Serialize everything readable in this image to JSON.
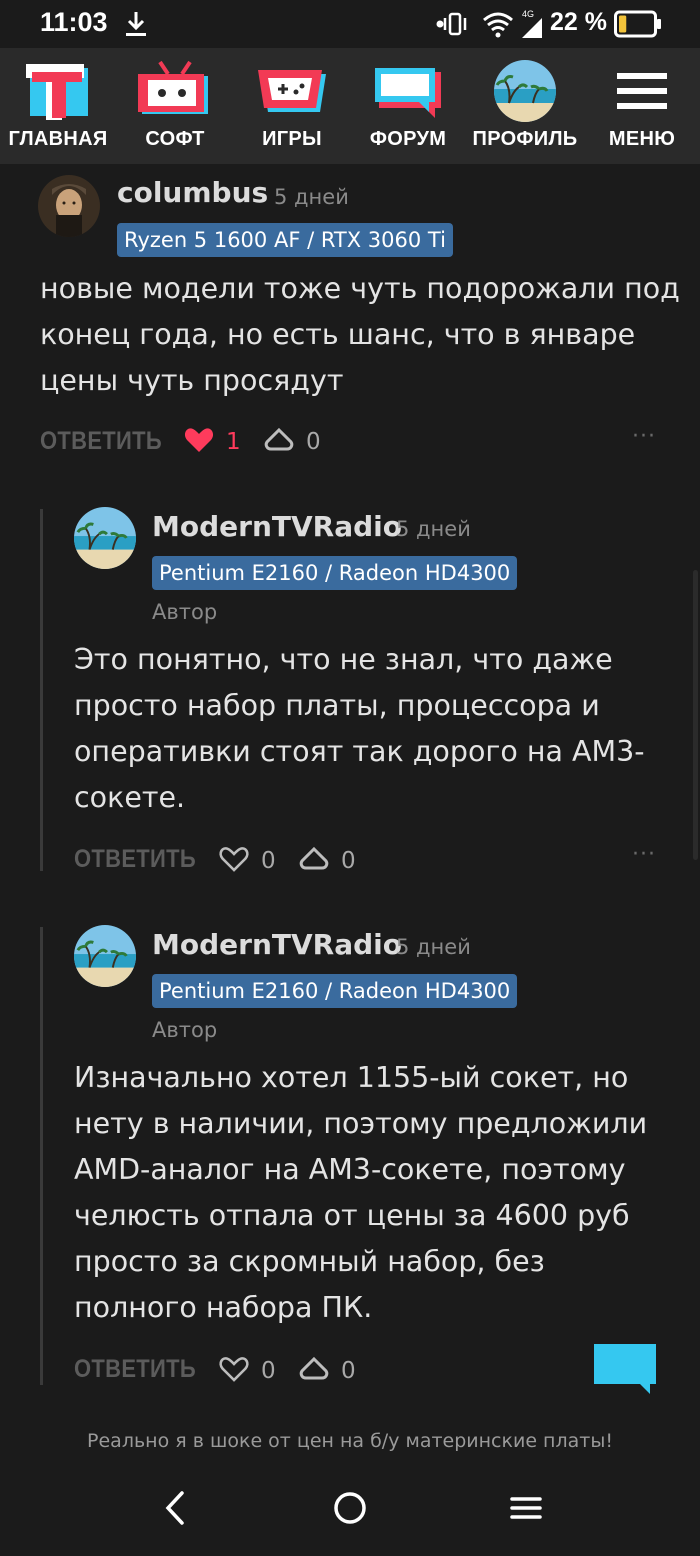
{
  "status_bar": {
    "time": "11:03",
    "network_label": "4G",
    "battery_text": "22 %",
    "battery_level": 0.22
  },
  "nav": {
    "items": [
      {
        "label": "ГЛАВНАЯ",
        "icon": "home-t-logo-icon"
      },
      {
        "label": "СОФТ",
        "icon": "tv-robot-icon"
      },
      {
        "label": "ИГРЫ",
        "icon": "gamepad-icon"
      },
      {
        "label": "ФОРУМ",
        "icon": "forum-chat-icon"
      },
      {
        "label": "ПРОФИЛЬ",
        "icon": "profile-avatar-icon"
      },
      {
        "label": "МЕНЮ",
        "icon": "hamburger-menu-icon"
      }
    ]
  },
  "colors": {
    "accent_red": "#f23a55",
    "accent_cyan": "#35c8f0",
    "badge_blue": "#3a6b9e",
    "like_active": "#ff3b5c"
  },
  "comments": [
    {
      "username": "columbus",
      "time": "5 дней",
      "badge": "Ryzen 5 1600 AF / RTX 3060 Ti",
      "author_tag": "",
      "text": "новые модели тоже чуть подорожали под конец года, но есть шанс, что в январе цены чуть просядут",
      "reply_label": "ОТВЕТИТЬ",
      "likes": "1",
      "liked": true,
      "rating": "0",
      "more": "···"
    },
    {
      "username": "ModernTVRadio",
      "time": "5 дней",
      "badge": "Pentium E2160 / Radeon HD4300",
      "author_tag": "Автор",
      "text": "Это понятно, что не знал, что даже просто набор платы, процессора и оперативки стоят так дорого на AM3-сокете.",
      "reply_label": "ОТВЕТИТЬ",
      "likes": "0",
      "liked": false,
      "rating": "0",
      "more": "···"
    },
    {
      "username": "ModernTVRadio",
      "time": "5 дней",
      "badge": "Pentium E2160 / Radeon HD4300",
      "author_tag": "Автор",
      "text": "Изначально хотел 1155-ый сокет, но нету в наличии, поэтому предложили AMD-аналог на AM3-сокете, поэтому челюсть отпала от цены за 4600 руб просто за скромный набор, без полного набора ПК.",
      "reply_label": "ОТВЕТИТЬ",
      "likes": "0",
      "liked": false,
      "rating": "0"
    }
  ],
  "footer": {
    "title_text": "Реально я в шоке от цен на б/у материнские платы!"
  }
}
